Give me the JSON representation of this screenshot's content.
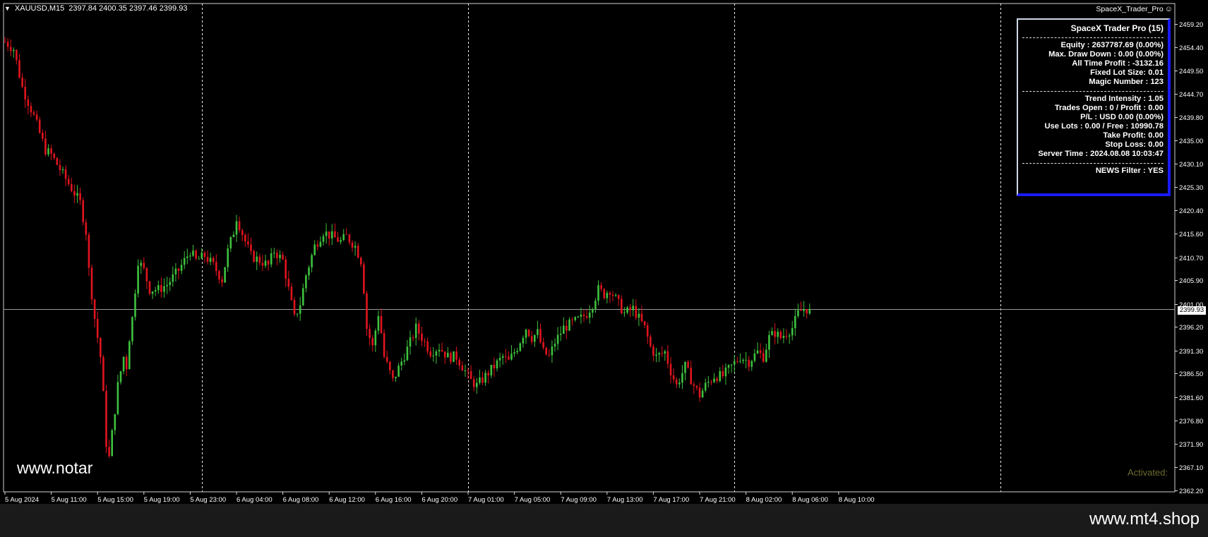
{
  "symbol_header": {
    "symbol": "XAUUSD,M15",
    "quote": "2397.84 2400.35 2397.46 2399.93"
  },
  "ea_label": "SpaceX_Trader_Pro",
  "info_panel": {
    "title": "SpaceX Trader Pro (15)",
    "group1": [
      "Equity : 2637787.69 (0.00%)",
      "Max. Draw Down : 0.00 (0.00%)",
      "All Time Profit : -3132.16",
      "Fixed Lot Size: 0.01",
      "Magic Number : 123"
    ],
    "group2": [
      "Trend Intensity : 1.05",
      "Trades Open : 0 / Profit : 0.00",
      "P/L : USD 0.00 (0.00%)",
      "Use Lots : 0.00 / Free : 10990.78",
      "Take Profit: 0.00",
      "Stop Loss: 0.00",
      "Server Time : 2024.08.08 10:03:47"
    ],
    "news": "NEWS Filter : YES",
    "border_color": "#1a1aff"
  },
  "watermark": "www.notar",
  "activated_label": "Activated:",
  "current_price_tag": "2399.93",
  "footer_url": "www.mt4.shop",
  "colors": {
    "bull": "#3ec13e",
    "bear": "#e0141e",
    "background": "#000000",
    "grid": "#ffffff"
  },
  "chart_data": {
    "type": "candlestick",
    "symbol": "XAUUSD",
    "timeframe": "M15",
    "current_price": 2399.93,
    "ylim": [
      2362.2,
      2459.2
    ],
    "y_ticks": [
      "2459.20",
      "2454.40",
      "2449.50",
      "2444.70",
      "2439.80",
      "2435.00",
      "2430.10",
      "2425.30",
      "2420.40",
      "2415.60",
      "2410.70",
      "2405.90",
      "2401.00",
      "2396.20",
      "2391.30",
      "2386.50",
      "2381.60",
      "2376.80",
      "2371.90",
      "2367.10",
      "2362.20"
    ],
    "x_ticks": [
      "5 Aug 2024",
      "5 Aug 11:00",
      "5 Aug 15:00",
      "5 Aug 19:00",
      "5 Aug 23:00",
      "6 Aug 04:00",
      "6 Aug 08:00",
      "6 Aug 12:00",
      "6 Aug 16:00",
      "6 Aug 20:00",
      "7 Aug 01:00",
      "7 Aug 05:00",
      "7 Aug 09:00",
      "7 Aug 13:00",
      "7 Aug 17:00",
      "7 Aug 21:00",
      "8 Aug 02:00",
      "8 Aug 06:00",
      "8 Aug 10:00"
    ],
    "x_tick_offsets": [
      0,
      16,
      32,
      48,
      64,
      80,
      96,
      112,
      128,
      144,
      160,
      176,
      192,
      208,
      224,
      240,
      256,
      272,
      288
    ],
    "period_separators": [
      68,
      160,
      252,
      344
    ],
    "total_slots": 420,
    "close_path": [
      [
        0,
        2455.5
      ],
      [
        3,
        2454
      ],
      [
        6,
        2446
      ],
      [
        10,
        2440
      ],
      [
        14,
        2433
      ],
      [
        16,
        2432
      ],
      [
        20,
        2428
      ],
      [
        24,
        2424
      ],
      [
        26,
        2422
      ],
      [
        28,
        2416
      ],
      [
        29,
        2408
      ],
      [
        31,
        2398
      ],
      [
        33,
        2390
      ],
      [
        34,
        2382
      ],
      [
        35,
        2372
      ],
      [
        36,
        2369
      ],
      [
        37,
        2374
      ],
      [
        39,
        2384
      ],
      [
        41,
        2390
      ],
      [
        42,
        2388
      ],
      [
        43,
        2394
      ],
      [
        44,
        2398
      ],
      [
        45,
        2404
      ],
      [
        46,
        2410
      ],
      [
        48,
        2408
      ],
      [
        50,
        2404
      ],
      [
        53,
        2404
      ],
      [
        56,
        2405
      ],
      [
        60,
        2408
      ],
      [
        62,
        2410
      ],
      [
        64,
        2412
      ],
      [
        66,
        2410
      ],
      [
        69,
        2411
      ],
      [
        72,
        2409
      ],
      [
        75,
        2406
      ],
      [
        77,
        2412
      ],
      [
        79,
        2416
      ],
      [
        80,
        2419
      ],
      [
        83,
        2414
      ],
      [
        85,
        2411
      ],
      [
        88,
        2410
      ],
      [
        91,
        2409
      ],
      [
        93,
        2412
      ],
      [
        96,
        2410
      ],
      [
        98,
        2404
      ],
      [
        100,
        2398
      ],
      [
        102,
        2401
      ],
      [
        104,
        2407
      ],
      [
        107,
        2413
      ],
      [
        110,
        2416
      ],
      [
        113,
        2415
      ],
      [
        116,
        2414
      ],
      [
        118,
        2415
      ],
      [
        121,
        2413
      ],
      [
        123,
        2410
      ],
      [
        124,
        2404
      ],
      [
        125,
        2396
      ],
      [
        127,
        2392
      ],
      [
        129,
        2399
      ],
      [
        130,
        2395
      ],
      [
        131,
        2390
      ],
      [
        134,
        2385
      ],
      [
        137,
        2389
      ],
      [
        140,
        2393
      ],
      [
        142,
        2396
      ],
      [
        145,
        2393
      ],
      [
        147,
        2391
      ],
      [
        150,
        2392
      ],
      [
        153,
        2390
      ],
      [
        156,
        2390
      ],
      [
        158,
        2388
      ],
      [
        161,
        2385
      ],
      [
        163,
        2384
      ],
      [
        166,
        2386
      ],
      [
        169,
        2388
      ],
      [
        172,
        2390
      ],
      [
        174,
        2389
      ],
      [
        177,
        2392
      ],
      [
        180,
        2396
      ],
      [
        182,
        2394
      ],
      [
        184,
        2395
      ],
      [
        186,
        2391
      ],
      [
        188,
        2390
      ],
      [
        190,
        2393
      ],
      [
        193,
        2396
      ],
      [
        196,
        2397
      ],
      [
        199,
        2398
      ],
      [
        201,
        2399
      ],
      [
        203,
        2401
      ],
      [
        205,
        2404
      ],
      [
        207,
        2403
      ],
      [
        209,
        2404
      ],
      [
        212,
        2401
      ],
      [
        214,
        2399
      ],
      [
        217,
        2400
      ],
      [
        219,
        2398
      ],
      [
        221,
        2396
      ],
      [
        223,
        2392
      ],
      [
        225,
        2390
      ],
      [
        228,
        2391
      ],
      [
        230,
        2387
      ],
      [
        232,
        2384
      ],
      [
        235,
        2388
      ],
      [
        238,
        2384
      ],
      [
        240,
        2382
      ],
      [
        242,
        2384
      ],
      [
        245,
        2386
      ],
      [
        248,
        2386
      ],
      [
        251,
        2388
      ],
      [
        254,
        2390
      ],
      [
        257,
        2389
      ],
      [
        260,
        2391
      ],
      [
        262,
        2390
      ],
      [
        264,
        2394
      ],
      [
        266,
        2395
      ],
      [
        268,
        2394
      ],
      [
        270,
        2395
      ],
      [
        272,
        2396
      ],
      [
        274,
        2399
      ],
      [
        276,
        2400
      ],
      [
        278,
        2399.9
      ]
    ]
  }
}
